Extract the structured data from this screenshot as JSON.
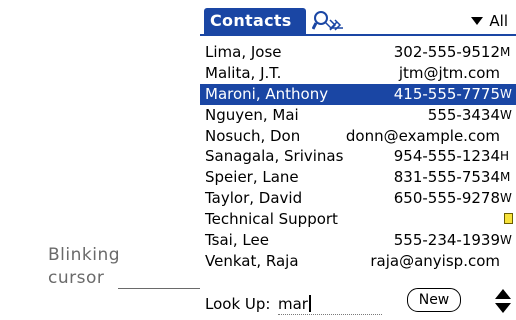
{
  "callout": {
    "text": "Blinking cursor"
  },
  "header": {
    "title": "Contacts",
    "category": "All"
  },
  "contacts": [
    {
      "name": "Lima, Jose",
      "value": "302-555-9512",
      "tag": "M",
      "selected": false,
      "note": false
    },
    {
      "name": "Malita, J.T.",
      "value": "jtm@jtm.com",
      "tag": "",
      "selected": false,
      "note": false
    },
    {
      "name": "Maroni, Anthony",
      "value": "415-555-7775",
      "tag": "W",
      "selected": true,
      "note": false
    },
    {
      "name": "Nguyen, Mai",
      "value": "555-3434",
      "tag": "W",
      "selected": false,
      "note": false
    },
    {
      "name": "Nosuch, Don",
      "value": "donn@example.com",
      "tag": "",
      "selected": false,
      "note": false
    },
    {
      "name": "Sanagala, Srivinas",
      "value": "954-555-1234",
      "tag": "H",
      "selected": false,
      "note": false
    },
    {
      "name": "Speier, Lane",
      "value": "831-555-7534",
      "tag": "M",
      "selected": false,
      "note": false
    },
    {
      "name": "Taylor, David",
      "value": "650-555-9278",
      "tag": "W",
      "selected": false,
      "note": false
    },
    {
      "name": "Technical Support",
      "value": "",
      "tag": "",
      "selected": false,
      "note": true
    },
    {
      "name": "Tsai, Lee",
      "value": "555-234-1939",
      "tag": "W",
      "selected": false,
      "note": false
    },
    {
      "name": "Venkat, Raja",
      "value": "raja@anyisp.com",
      "tag": "",
      "selected": false,
      "note": false
    }
  ],
  "lookup": {
    "label": "Look Up:",
    "value": "mar"
  },
  "buttons": {
    "new_label": "New"
  },
  "icons": {
    "search": "magnifier-icon",
    "category": "triangle-down-icon",
    "note": "note-icon",
    "scroll": "scroll-arrows-icon"
  },
  "colors": {
    "accent": "#1a46a4",
    "note": "#f7e23b",
    "callout": "#6a6a6a"
  }
}
